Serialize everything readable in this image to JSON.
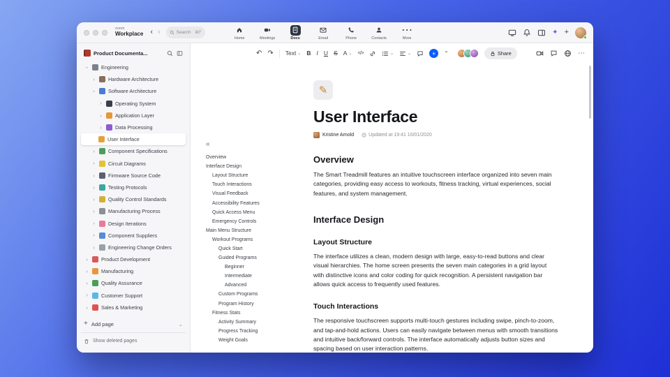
{
  "colors": {
    "accent_blue": "#0B5CFF",
    "active_tab_bg": "#2E3642",
    "background_top": "#86A7F2",
    "background_bottom": "#1E30D6",
    "selected_row_bg": "#FFFFFF"
  },
  "icons": {
    "undo": "↶",
    "redo": "↷",
    "back": "‹",
    "forward": "›",
    "chevron_right": "›",
    "chevron_down": "›",
    "caret_down": "⌄",
    "caret_up": "⌃",
    "collapse_outline": "«",
    "more_dots": "⋯",
    "plus": "+",
    "sparkle": "✦",
    "code": "</>",
    "pencil": "✎"
  },
  "titlebar": {
    "logo_top": "zoom",
    "logo_bottom": "Workplace",
    "search_placeholder": "Search",
    "search_shortcut": "⌘F",
    "tabs": [
      {
        "label": "Home"
      },
      {
        "label": "Meetings"
      },
      {
        "label": "Docs"
      },
      {
        "label": "Email"
      },
      {
        "label": "Phone"
      },
      {
        "label": "Contacts"
      },
      {
        "label": "More"
      }
    ]
  },
  "sidebar": {
    "workspace_label": "Product Documenta...",
    "tree": [
      {
        "label": "Engineering"
      },
      {
        "label": "Hardware Architecture"
      },
      {
        "label": "Software Architecture"
      },
      {
        "label": "Operating System"
      },
      {
        "label": "Application Layer"
      },
      {
        "label": "Data Processing"
      },
      {
        "label": "User Interface"
      },
      {
        "label": "Component Specifications"
      },
      {
        "label": "Circuit Diagrams"
      },
      {
        "label": "Firmware Source Code"
      },
      {
        "label": "Testing Protocols"
      },
      {
        "label": "Quality Control Standards"
      },
      {
        "label": "Manufacturing Process"
      },
      {
        "label": "Design Iterations"
      },
      {
        "label": "Component Suppliers"
      },
      {
        "label": "Engineering Change Orders"
      },
      {
        "label": "Product Development"
      },
      {
        "label": "Manufacturing"
      },
      {
        "label": "Quality Assurance"
      },
      {
        "label": "Customer Support"
      },
      {
        "label": "Sales & Marketing"
      }
    ],
    "add_page": "Add page",
    "show_deleted": "Show deleted pages"
  },
  "outline": {
    "items": [
      {
        "label": "Overview"
      },
      {
        "label": "Interface Design"
      },
      {
        "label": "Layout Structure"
      },
      {
        "label": "Touch Interactions"
      },
      {
        "label": "Visual Feedback"
      },
      {
        "label": "Accessibility Features"
      },
      {
        "label": "Quick Access Menu"
      },
      {
        "label": "Emergency Controls"
      },
      {
        "label": "Main Menu Structure"
      },
      {
        "label": "Workout Programs"
      },
      {
        "label": "Quick Start"
      },
      {
        "label": "Guided Programs"
      },
      {
        "label": "Beginner"
      },
      {
        "label": "Intermediate"
      },
      {
        "label": "Advanced"
      },
      {
        "label": "Custom Programs"
      },
      {
        "label": "Program History"
      },
      {
        "label": "Fitness Stats"
      },
      {
        "label": "Activity Summary"
      },
      {
        "label": "Progress Tracking"
      },
      {
        "label": "Weight Goals"
      }
    ]
  },
  "doc_toolbar": {
    "style_selector": "Text",
    "bold": "B",
    "italic": "I",
    "underline": "U",
    "strikethrough": "S",
    "text_color": "A",
    "share_label": "Share"
  },
  "doc": {
    "title": "User Interface",
    "author": "Kristine Arnold",
    "updated": "Updated at 19:41 10/01/2020",
    "overview_heading": "Overview",
    "overview_text": "The Smart Treadmill features an intuitive touchscreen interface organized into seven main categories, providing easy access to workouts, fitness tracking, virtual experiences, social features, and system management.",
    "interface_design_heading": "Interface Design",
    "layout_structure_heading": "Layout Structure",
    "layout_structure_text": "The interface utilizes a clean, modern design with large, easy-to-read buttons and clear visual hierarchies. The home screen presents the seven main categories in a grid layout with distinctive icons and color coding for quick recognition. A persistent navigation bar allows quick access to frequently used features.",
    "touch_interactions_heading": "Touch Interactions",
    "touch_interactions_text": "The responsive touchscreen supports multi-touch gestures including swipe, pinch-to-zoom, and tap-and-hold actions. Users can easily navigate between menus with smooth transitions and intuitive back/forward controls. The interface automatically adjusts button sizes and spacing based on user interaction patterns."
  }
}
